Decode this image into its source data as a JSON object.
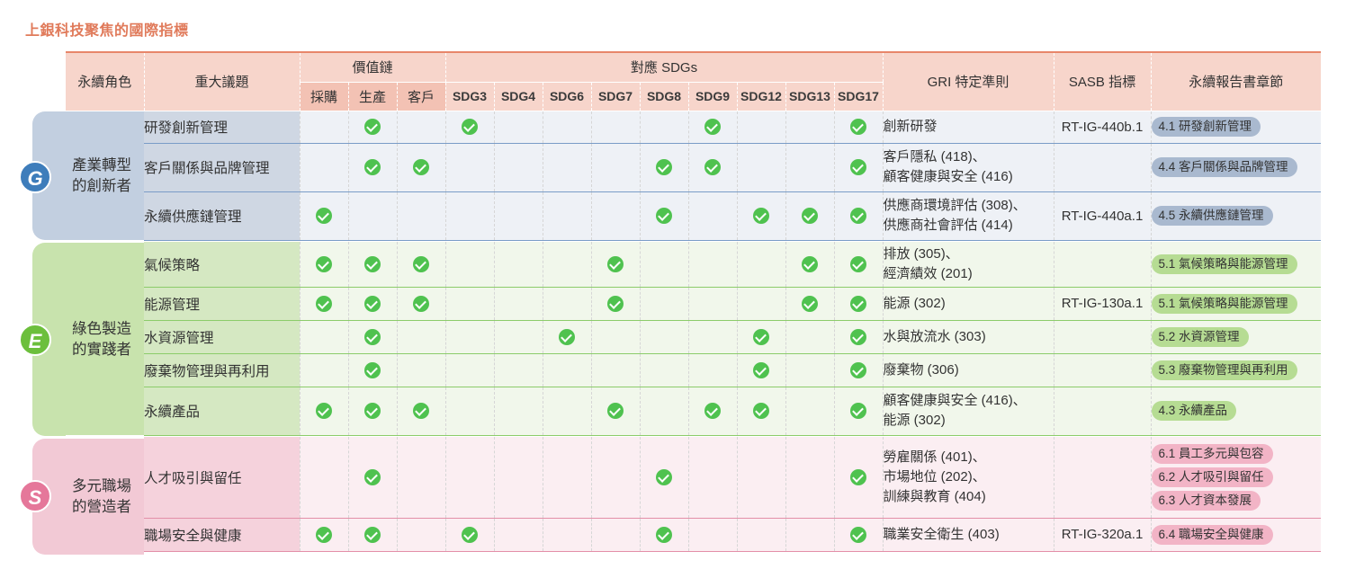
{
  "title": "上銀科技聚焦的國際指標",
  "headers": {
    "role": "永續角色",
    "issue": "重大議題",
    "value_chain": "價值鏈",
    "value_chain_cols": [
      "採購",
      "生產",
      "客戶"
    ],
    "sdgs": "對應 SDGs",
    "sdg_cols": [
      "SDG3",
      "SDG4",
      "SDG6",
      "SDG7",
      "SDG8",
      "SDG9",
      "SDG12",
      "SDG13",
      "SDG17"
    ],
    "gri": "GRI 特定準則",
    "sasb": "SASB 指標",
    "chapter": "永續報告書章節"
  },
  "roles": [
    {
      "letter": "G",
      "line1": "產業轉型",
      "line2": "的創新者",
      "color": "#3e7dbb"
    },
    {
      "letter": "E",
      "line1": "綠色製造",
      "line2": "的實踐者",
      "color": "#6cbf3c"
    },
    {
      "letter": "S",
      "line1": "多元職場",
      "line2": "的營造者",
      "color": "#e5779a"
    }
  ],
  "rows": [
    {
      "group": "g",
      "issue": "研發創新管理",
      "vc": [
        false,
        true,
        false
      ],
      "sdg": [
        true,
        false,
        false,
        false,
        false,
        true,
        false,
        false,
        true
      ],
      "gri": [
        "創新研發"
      ],
      "sasb": "RT-IG-440b.1",
      "chapters": [
        "4.1 研發創新管理"
      ]
    },
    {
      "group": "g",
      "issue": "客戶關係與品牌管理",
      "vc": [
        false,
        true,
        true
      ],
      "sdg": [
        false,
        false,
        false,
        false,
        true,
        true,
        false,
        false,
        true
      ],
      "gri": [
        "客戶隱私 (418)、",
        "顧客健康與安全 (416)"
      ],
      "sasb": "",
      "chapters": [
        "4.4 客戶關係與品牌管理"
      ]
    },
    {
      "group": "g",
      "issue": "永續供應鏈管理",
      "vc": [
        true,
        false,
        false
      ],
      "sdg": [
        false,
        false,
        false,
        false,
        true,
        false,
        true,
        true,
        true
      ],
      "gri": [
        "供應商環境評估 (308)、",
        "供應商社會評估 (414)"
      ],
      "sasb": "RT-IG-440a.1",
      "chapters": [
        "4.5 永續供應鏈管理"
      ]
    },
    {
      "group": "e",
      "issue": "氣候策略",
      "vc": [
        true,
        true,
        true
      ],
      "sdg": [
        false,
        false,
        false,
        true,
        false,
        false,
        false,
        true,
        true
      ],
      "gri": [
        "排放 (305)、",
        "經濟績效 (201)"
      ],
      "sasb": "",
      "chapters": [
        "5.1 氣候策略與能源管理"
      ]
    },
    {
      "group": "e",
      "issue": "能源管理",
      "vc": [
        true,
        true,
        true
      ],
      "sdg": [
        false,
        false,
        false,
        true,
        false,
        false,
        false,
        true,
        true
      ],
      "gri": [
        "能源 (302)"
      ],
      "sasb": "RT-IG-130a.1",
      "chapters": [
        "5.1 氣候策略與能源管理"
      ]
    },
    {
      "group": "e",
      "issue": "水資源管理",
      "vc": [
        false,
        true,
        false
      ],
      "sdg": [
        false,
        false,
        true,
        false,
        false,
        false,
        true,
        false,
        true
      ],
      "gri": [
        "水與放流水 (303)"
      ],
      "sasb": "",
      "chapters": [
        "5.2 水資源管理"
      ]
    },
    {
      "group": "e",
      "issue": "廢棄物管理與再利用",
      "vc": [
        false,
        true,
        false
      ],
      "sdg": [
        false,
        false,
        false,
        false,
        false,
        false,
        true,
        false,
        true
      ],
      "gri": [
        "廢棄物 (306)"
      ],
      "sasb": "",
      "chapters": [
        "5.3 廢棄物管理與再利用"
      ]
    },
    {
      "group": "e",
      "issue": "永續產品",
      "vc": [
        true,
        true,
        true
      ],
      "sdg": [
        false,
        false,
        false,
        true,
        false,
        true,
        true,
        false,
        true
      ],
      "gri": [
        "顧客健康與安全 (416)、",
        "能源 (302)"
      ],
      "sasb": "",
      "chapters": [
        "4.3 永續產品"
      ]
    },
    {
      "group": "s",
      "issue": "人才吸引與留任",
      "vc": [
        false,
        true,
        false
      ],
      "sdg": [
        false,
        false,
        false,
        false,
        true,
        false,
        false,
        false,
        true
      ],
      "gri": [
        "勞雇關係 (401)、",
        "市場地位 (202)、",
        "訓練與教育 (404)"
      ],
      "sasb": "",
      "chapters": [
        "6.1 員工多元與包容",
        "6.2 人才吸引與留任",
        "6.3 人才資本發展"
      ]
    },
    {
      "group": "s",
      "issue": "職場安全與健康",
      "vc": [
        true,
        true,
        false
      ],
      "sdg": [
        true,
        false,
        false,
        false,
        true,
        false,
        false,
        false,
        true
      ],
      "gri": [
        "職業安全衛生 (403)"
      ],
      "sasb": "RT-IG-320a.1",
      "chapters": [
        "6.4 職場安全與健康"
      ]
    }
  ]
}
